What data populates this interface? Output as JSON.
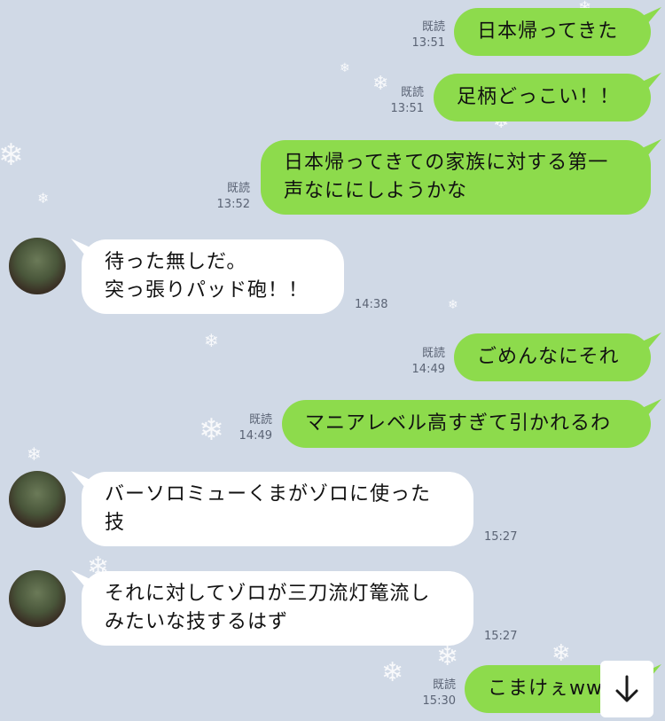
{
  "messages": [
    {
      "side": "out",
      "lines": [
        "日本帰ってきた"
      ],
      "read": "既読",
      "time": "13:51"
    },
    {
      "side": "out",
      "lines": [
        "足柄どっこい！！"
      ],
      "read": "既読",
      "time": "13:51"
    },
    {
      "side": "out",
      "lines": [
        "日本帰ってきての家族に対する第一",
        "声なににしようかな"
      ],
      "read": "既読",
      "time": "13:52"
    },
    {
      "side": "in",
      "lines": [
        "待った無しだ。",
        "突っ張りパッド砲！！"
      ],
      "time": "14:38"
    },
    {
      "side": "out",
      "lines": [
        "ごめんなにそれ"
      ],
      "read": "既読",
      "time": "14:49"
    },
    {
      "side": "out",
      "lines": [
        "マニアレベル高すぎて引かれるわ"
      ],
      "read": "既読",
      "time": "14:49"
    },
    {
      "side": "in",
      "lines": [
        "バーソロミューくまがゾロに使った",
        "技"
      ],
      "time": "15:27"
    },
    {
      "side": "in",
      "lines": [
        "それに対してゾロが三刀流灯篭流し",
        "みたいな技するはず"
      ],
      "time": "15:27"
    },
    {
      "side": "out",
      "lines": [
        "こまけぇwww"
      ],
      "read": "既読",
      "time": "15:30"
    }
  ],
  "icons": {
    "scroll_down": "arrow-down-icon",
    "snow": "snowflake-icon",
    "avatar": "avatar"
  },
  "colors": {
    "background": "#d0d9e6",
    "outgoing": "#8ddb4c",
    "incoming": "#ffffff"
  }
}
